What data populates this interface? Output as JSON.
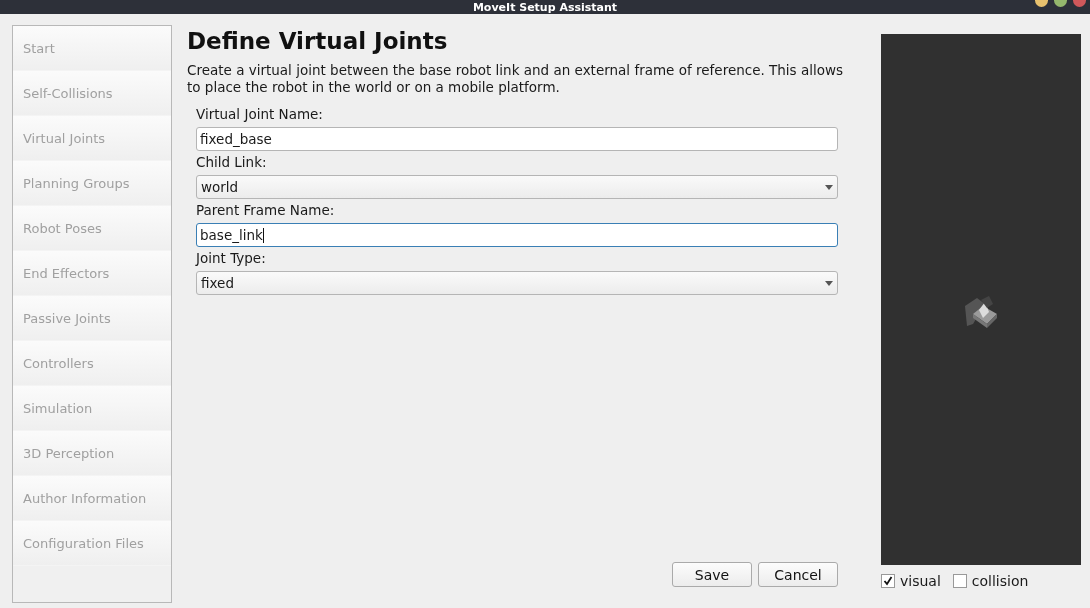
{
  "window": {
    "title": "MoveIt Setup Assistant"
  },
  "sidebar": {
    "items": [
      {
        "label": "Start"
      },
      {
        "label": "Self-Collisions"
      },
      {
        "label": "Virtual Joints"
      },
      {
        "label": "Planning Groups"
      },
      {
        "label": "Robot Poses"
      },
      {
        "label": "End Effectors"
      },
      {
        "label": "Passive Joints"
      },
      {
        "label": "Controllers"
      },
      {
        "label": "Simulation"
      },
      {
        "label": "3D Perception"
      },
      {
        "label": "Author Information"
      },
      {
        "label": "Configuration Files"
      }
    ]
  },
  "page": {
    "title": "Define Virtual Joints",
    "description": "Create a virtual joint between the base robot link and an external frame of reference. This allows to place the robot in the world or on a mobile platform.",
    "fields": [
      {
        "label": "Virtual Joint Name:",
        "kind": "text",
        "value": "fixed_base",
        "focused": false
      },
      {
        "label": "Child Link:",
        "kind": "combo",
        "value": "world",
        "focused": false
      },
      {
        "label": "Parent Frame Name:",
        "kind": "text",
        "value": "base_link",
        "focused": true
      },
      {
        "label": "Joint Type:",
        "kind": "combo",
        "value": "fixed",
        "focused": false
      }
    ],
    "buttons": [
      "Save",
      "Cancel"
    ]
  },
  "viewer": {
    "options": [
      {
        "label": "visual",
        "checked": true
      },
      {
        "label": "collision",
        "checked": false
      }
    ]
  }
}
